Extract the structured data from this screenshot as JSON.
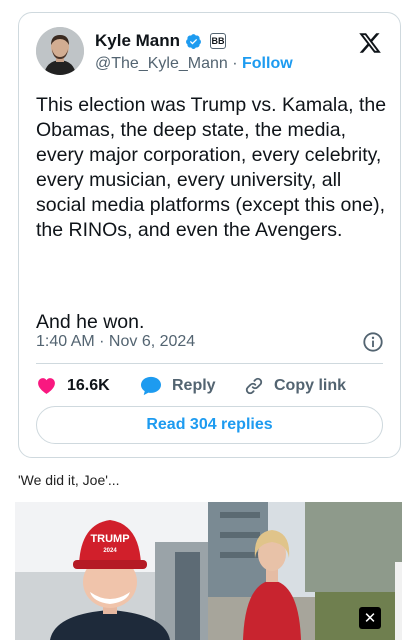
{
  "tweet": {
    "display_name": "Kyle Mann",
    "badge_text": "BB",
    "handle": "@The_Kyle_Mann",
    "separator": "·",
    "follow_label": "Follow",
    "body_text": "This election was Trump vs. Kamala, the Obamas, the deep state, the media, every major corporation, every celebrity, every musician, every university, all social media platforms (except this one), the RINOs, and even the Avengers.",
    "closing_text": "And he won.",
    "timestamp": "1:40 AM · Nov 6, 2024",
    "like_count": "16.6K",
    "reply_label": "Reply",
    "copy_link_label": "Copy link",
    "read_replies_label": "Read 304 replies"
  },
  "post": {
    "caption": "'We did it, Joe'...",
    "hat_text_line1": "TRUMP",
    "hat_text_line2": "2024",
    "close_label": "✕"
  },
  "colors": {
    "accent": "#1d9bf0",
    "like": "#f91880",
    "text_primary": "#0f1419",
    "text_secondary": "#536471"
  },
  "icons": {
    "verified": "verified-badge-icon",
    "x_logo": "x-logo-icon",
    "info": "info-icon",
    "heart": "heart-icon",
    "reply": "reply-bubble-icon",
    "link": "link-icon",
    "close": "close-icon"
  }
}
